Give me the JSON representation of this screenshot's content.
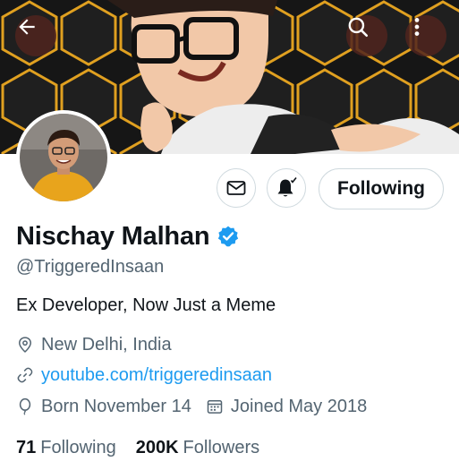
{
  "header": {
    "back_icon": "arrow-left-icon",
    "search_icon": "search-icon",
    "more_icon": "more-vertical-icon"
  },
  "profile": {
    "display_name": "Nischay Malhan",
    "verified": true,
    "handle": "@TriggeredInsaan",
    "bio": "Ex Developer, Now Just a Meme",
    "location": "New Delhi, India",
    "website": "youtube.com/triggeredinsaan",
    "birthday": "Born November 14",
    "joined": "Joined May 2018"
  },
  "actions": {
    "message_icon": "envelope-icon",
    "notify_icon": "bell-plus-icon",
    "follow_label": "Following"
  },
  "stats": {
    "following_count": "71",
    "following_label": "Following",
    "followers_count": "200K",
    "followers_label": "Followers"
  },
  "colors": {
    "accent": "#1d9bf0",
    "text_primary": "#0f1419",
    "text_secondary": "#536471",
    "border": "#cfd9de",
    "banner_glow": "#e8a31a"
  }
}
